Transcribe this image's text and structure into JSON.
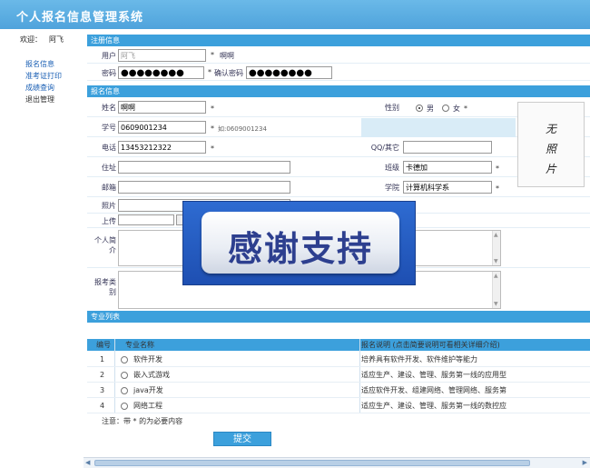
{
  "app": {
    "title": "个人报名信息管理系统"
  },
  "sidebar": {
    "welcome_label": "欢迎：",
    "user_name": "阿飞",
    "items": [
      {
        "label": "报名信息"
      },
      {
        "label": "准考证打印"
      },
      {
        "label": "成绩查询"
      },
      {
        "label": "退出管理"
      }
    ]
  },
  "register": {
    "section_title": "注册信息",
    "user_label": "用户",
    "user_value": "阿飞",
    "user_note": "啊啊",
    "password_label": "密码",
    "password_value": "●●●●●●●●",
    "confirm_label": "确认密码",
    "confirm_value": "●●●●●●●●"
  },
  "signup": {
    "section_title": "报名信息",
    "name_label": "姓名",
    "name_value": "啊啊",
    "gender_label": "性别",
    "gender_male": "男",
    "gender_female": "女",
    "gender_selected": "男",
    "student_id_label": "学号",
    "student_id_value": "0609001234",
    "student_id_note": "如:0609001234",
    "phone_label": "电话",
    "phone_value": "13453212322",
    "qq_label": "QQ/其它",
    "qq_value": "",
    "address_label": "住址",
    "address_value": "",
    "class_label": "班级",
    "class_value": "卡德加",
    "email_label": "邮箱",
    "email_value": "",
    "college_label": "学院",
    "college_value": "计算机科学系",
    "photo_label": "照片",
    "photo_value": "",
    "upload_label": "上传",
    "intro_label": "个人简介",
    "category_label": "报考类别",
    "photo_placeholder": [
      "无",
      "照",
      "片"
    ],
    "required_mark": "*"
  },
  "majors": {
    "section_title": "专业列表",
    "columns": [
      "编号",
      "专业名称",
      "报名说明 (点击简要说明可看相关详细介绍)"
    ],
    "rows": [
      {
        "no": "1",
        "name": "软件开发",
        "desc": "培养具有软件开发、软件维护等能力"
      },
      {
        "no": "2",
        "name": "嵌入式游戏",
        "desc": "适应生产、建设、管理、服务第一线的应用型..."
      },
      {
        "no": "3",
        "name": "java开发",
        "desc": "适应软件开发、组建网络、管理网络、服务第..."
      },
      {
        "no": "4",
        "name": "网络工程",
        "desc": "适应生产、建设、管理、服务第一线的数控应..."
      }
    ],
    "notice": "注意：带 * 的为必要内容",
    "submit_label": "提交"
  },
  "overlay": {
    "text": "感谢支持"
  },
  "colors": {
    "accent": "#3ca0dc",
    "title_bar": "#5aaee2",
    "link": "#1a5fb4"
  }
}
